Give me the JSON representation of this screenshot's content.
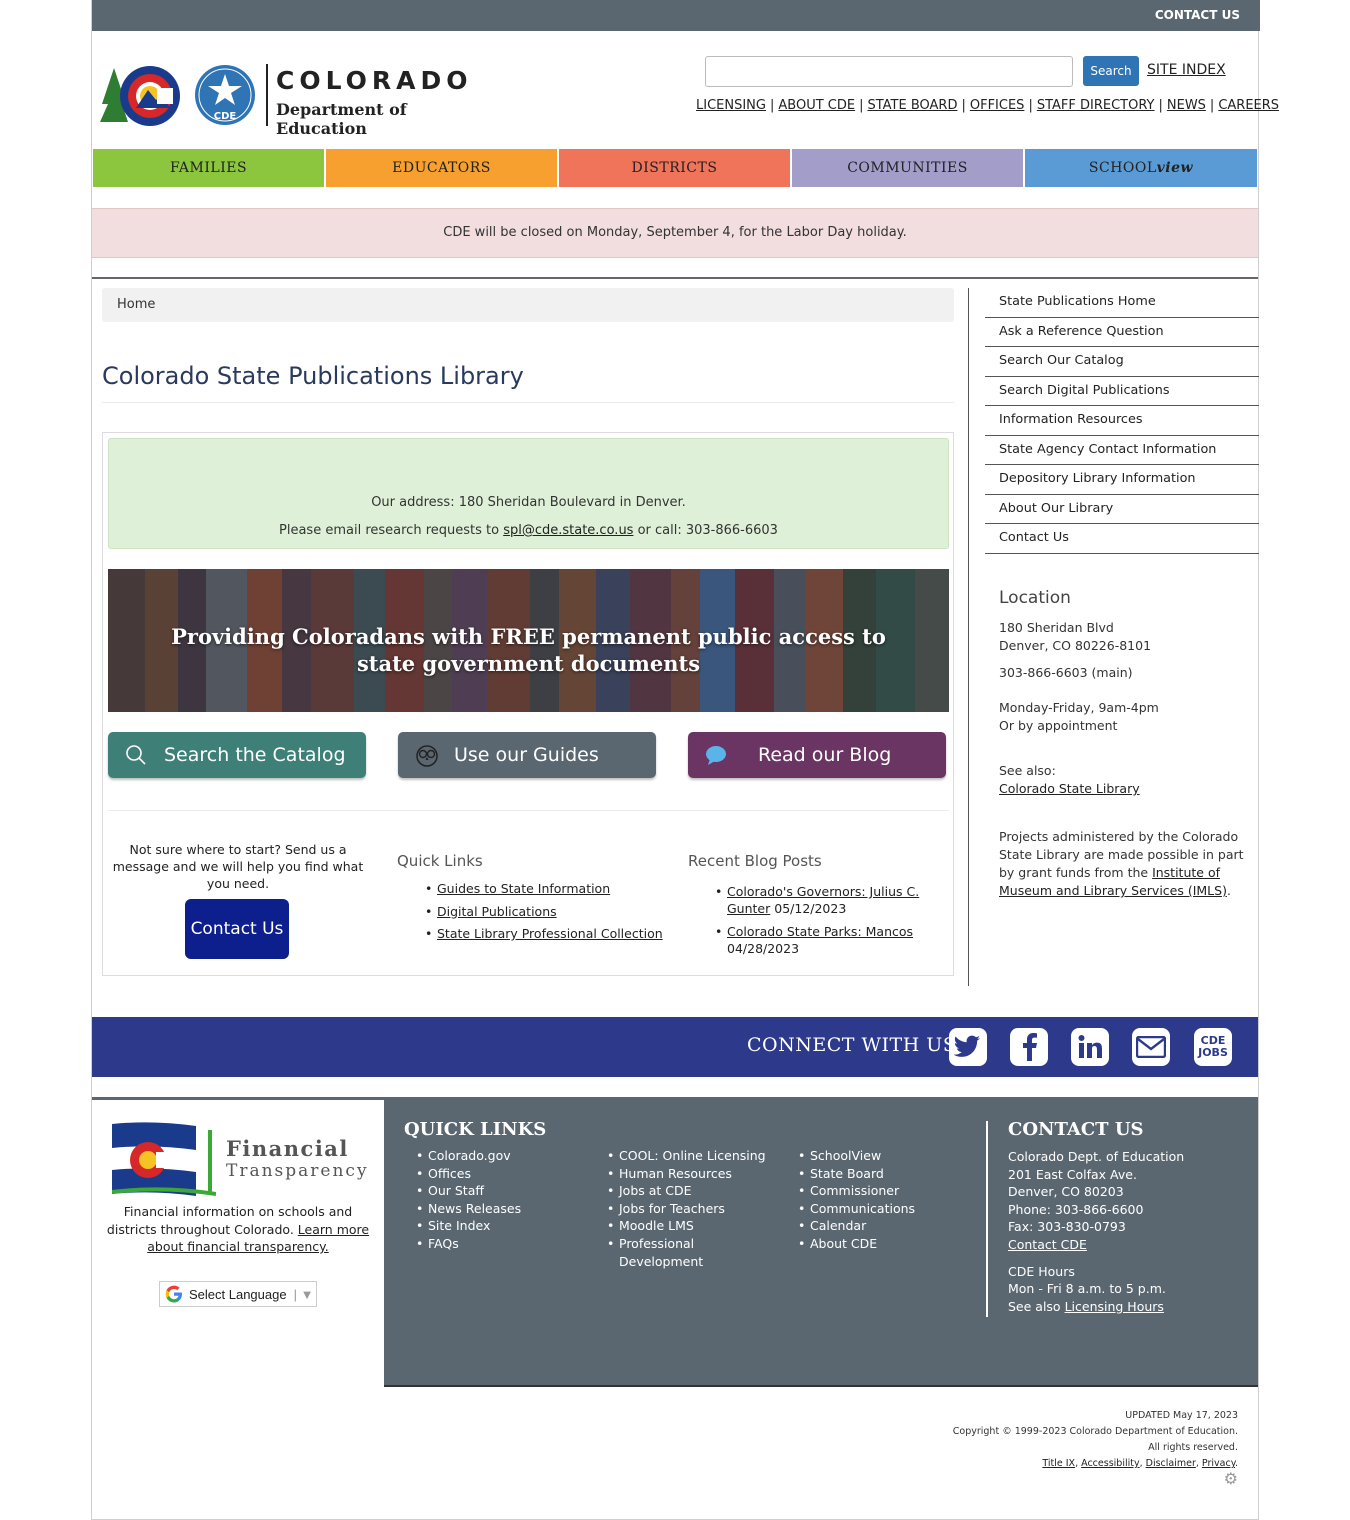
{
  "topbar": {
    "contact_label": "CONTACT US"
  },
  "header": {
    "logo_title": "COLORADO",
    "logo_subtitle": "Department of Education",
    "logo_seal_text": "CDE",
    "search_button": "Search",
    "site_index": "SITE INDEX",
    "util_links": [
      "LICENSING",
      "ABOUT CDE",
      "STATE BOARD",
      "OFFICES",
      "STAFF DIRECTORY",
      "NEWS",
      "CAREERS"
    ]
  },
  "mainnav": {
    "tabs": [
      {
        "label": "FAMILIES",
        "color": "#8cc63f"
      },
      {
        "label": "EDUCATORS",
        "color": "#f7a030"
      },
      {
        "label": "DISTRICTS",
        "color": "#ef7459"
      },
      {
        "label": "COMMUNITIES",
        "color": "#a29dc9"
      }
    ],
    "schoolview_a": "SCHOOL",
    "schoolview_b": "view",
    "schoolview_color": "#5b9bd5"
  },
  "alert": {
    "text": "CDE will be closed on Monday, September 4, for the Labor Day holiday."
  },
  "breadcrumb": {
    "home": "Home"
  },
  "page_title": "Colorado State Publications Library",
  "infobox": {
    "address": "Our address:  180 Sheridan Boulevard in Denver.",
    "email_prefix": "Please email research requests to ",
    "email": "spl@cde.state.co.us",
    "email_suffix": " or call: 303-866-6603"
  },
  "banner": {
    "text": "Providing Coloradans with FREE permanent public access to state government documents"
  },
  "cta": {
    "catalog": "Search the Catalog",
    "guides": "Use our Guides",
    "blog": "Read our Blog"
  },
  "col1": {
    "text": "Not sure where to start? Send us a message and we will help you find what you need.",
    "button": "Contact Us"
  },
  "quick_links": {
    "heading": "Quick Links",
    "items": [
      "Guides to State Information",
      "Digital Publications",
      "State Library Professional Collection"
    ]
  },
  "blog_posts": {
    "heading": "Recent Blog Posts",
    "items": [
      {
        "title": "Colorado's Governors: Julius C. Gunter",
        "date": "05/12/2023"
      },
      {
        "title": "Colorado State Parks: Mancos",
        "date": "04/28/2023"
      }
    ]
  },
  "sidenav": [
    "State Publications Home",
    "Ask a Reference Question",
    "Search Our Catalog",
    "Search Digital Publications",
    "Information Resources",
    "State Agency Contact Information",
    "Depository Library Information",
    "About Our Library",
    "Contact Us"
  ],
  "location": {
    "title": "Location",
    "addr1": "180 Sheridan Blvd",
    "addr2": "Denver, CO 80226-8101",
    "phone": "303-866-6603 (main)",
    "hours1": "Monday-Friday, 9am-4pm",
    "hours2": "Or by appointment",
    "see_also": "See also:",
    "see_also_link": "Colorado State Library",
    "imls_prefix": "Projects administered by the Colorado State Library are made possible in part by grant funds from the ",
    "imls_link": "Institute of Museum and Library Services (IMLS)",
    "imls_suffix": "."
  },
  "connect": {
    "label": "CONNECT WITH US",
    "icons": [
      "twitter-icon",
      "facebook-icon",
      "linkedin-icon",
      "email-icon",
      "cde-jobs-icon"
    ],
    "jobs_a": "CDE",
    "jobs_b": "JOBS"
  },
  "footer": {
    "fin_title1": "Financial",
    "fin_title2": "Transparency",
    "fin_text": "Financial information on schools and districts throughout Colorado. ",
    "fin_link": "Learn more about financial transparency.",
    "language": "Select Language",
    "quick_links_heading": "QUICK LINKS",
    "links_col1": [
      "Colorado.gov",
      "Offices",
      "Our Staff",
      "News Releases",
      "Site Index",
      "FAQs"
    ],
    "links_col2": [
      "COOL: Online Licensing",
      "Human Resources",
      "Jobs at CDE",
      "Jobs for Teachers",
      "Moodle LMS",
      "Professional Development"
    ],
    "links_col3": [
      "SchoolView",
      "State Board",
      "Commissioner",
      "Communications",
      "Calendar",
      "About CDE"
    ],
    "contact_heading": "CONTACT US",
    "contact_lines": [
      "Colorado Dept. of Education",
      "201 East Colfax Ave.",
      "Denver, CO 80203",
      "Phone: 303-866-6600",
      "Fax: 303-830-0793"
    ],
    "contact_link": "Contact CDE",
    "hours_title": "CDE Hours",
    "hours_line": "Mon - Fri 8 a.m. to 5 p.m.",
    "hours_see": "See also ",
    "hours_link": "Licensing Hours"
  },
  "bottom": {
    "updated": "UPDATED May 17, 2023",
    "copyright": "Copyright © 1999-2023 Colorado Department of Education.",
    "rights": "All rights reserved.",
    "links": [
      "Title IX",
      "Accessibility",
      "Disclaimer",
      "Privacy"
    ]
  }
}
